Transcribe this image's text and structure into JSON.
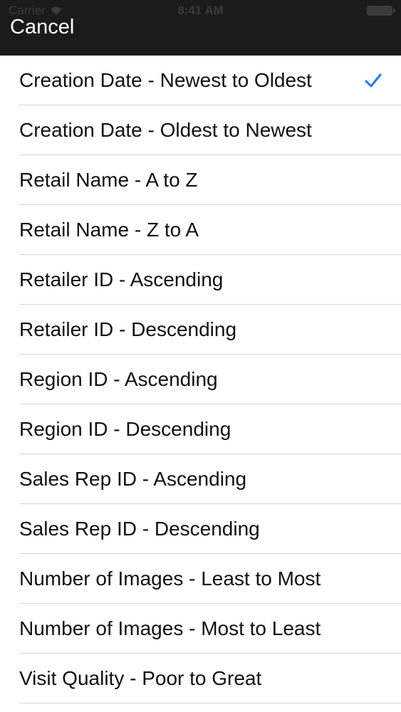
{
  "status_bar": {
    "carrier": "Carrier",
    "time": "8:41 AM"
  },
  "nav": {
    "cancel_label": "Cancel"
  },
  "sort_options": [
    {
      "label": "Creation Date - Newest to Oldest",
      "selected": true
    },
    {
      "label": "Creation Date - Oldest to Newest",
      "selected": false
    },
    {
      "label": "Retail Name - A to Z",
      "selected": false
    },
    {
      "label": "Retail Name - Z to A",
      "selected": false
    },
    {
      "label": "Retailer ID - Ascending",
      "selected": false
    },
    {
      "label": "Retailer ID - Descending",
      "selected": false
    },
    {
      "label": "Region ID - Ascending",
      "selected": false
    },
    {
      "label": "Region ID - Descending",
      "selected": false
    },
    {
      "label": "Sales Rep ID - Ascending",
      "selected": false
    },
    {
      "label": "Sales Rep ID - Descending",
      "selected": false
    },
    {
      "label": "Number of Images - Least to Most",
      "selected": false
    },
    {
      "label": "Number of Images - Most to Least",
      "selected": false
    },
    {
      "label": "Visit Quality - Poor to Great",
      "selected": false
    }
  ],
  "colors": {
    "nav_background": "#1b1b1b",
    "checkmark": "#1a7cf5",
    "separator": "#d6d6d9"
  }
}
